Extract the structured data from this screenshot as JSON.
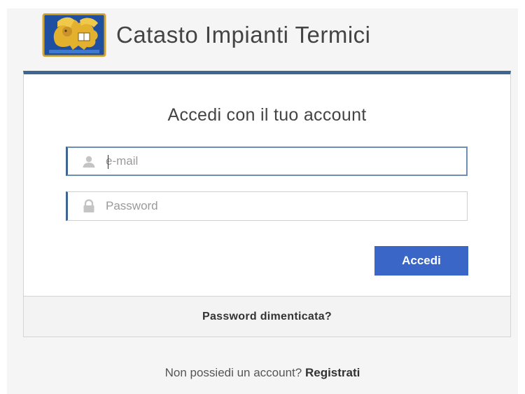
{
  "header": {
    "title": "Catasto Impianti Termici",
    "logo_icon": "regione-veneto-lion-crest"
  },
  "login": {
    "heading": "Accedi con il tuo account",
    "email": {
      "placeholder": "e-mail",
      "value": "",
      "icon": "user-icon"
    },
    "password": {
      "placeholder": "Password",
      "value": "",
      "icon": "lock-icon"
    },
    "submit_label": "Accedi",
    "forgot_label": "Password dimenticata?"
  },
  "signup": {
    "prompt": "Non possiedi un account?",
    "link_label": "Registrati"
  },
  "colors": {
    "accent": "#3f6690",
    "button": "#3a66c8"
  }
}
